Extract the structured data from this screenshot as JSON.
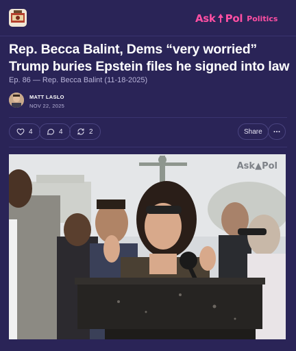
{
  "header": {
    "brand_ask": "Ask",
    "brand_pol": "Pol",
    "brand_suffix": "Politics",
    "pub_icon": "publication-logo",
    "pub_icon_alt": "Ask Pol"
  },
  "post": {
    "title": "Rep. Becca Balint, Dems “very worried” Trump buries Epstein files he signed into law",
    "subtitle": "Ep. 86 — Rep. Becca Balint (11-18-2025)",
    "author": "MATT LASLO",
    "date": "NOV 22, 2025"
  },
  "actions": {
    "likes": "4",
    "comments": "4",
    "restacks": "2",
    "share_label": "Share",
    "more_icon": "more-horizontal-icon"
  },
  "image": {
    "watermark_ask": "Ask",
    "watermark_pol": "Pol"
  },
  "colors": {
    "background": "#2a2457",
    "brand_pink": "#ff4fa3"
  }
}
